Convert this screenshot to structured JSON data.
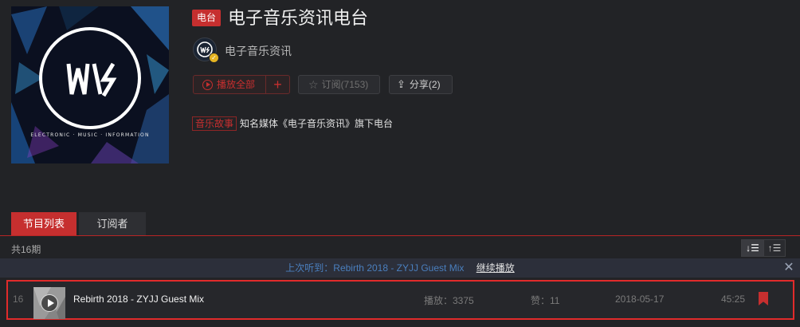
{
  "radio": {
    "type_badge": "电台",
    "title": "电子音乐资讯电台",
    "creator_name": "电子音乐资讯",
    "category": "音乐故事",
    "description": "知名媒体《电子音乐资讯》旗下电台",
    "cover_caption": "ELECTRONIC · MUSIC · INFORMATION"
  },
  "actions": {
    "play_all_label": "播放全部",
    "add_label": "+",
    "subscribe_label": "订阅(7153)",
    "share_label": "分享(2)"
  },
  "tabs": [
    {
      "label": "节目列表",
      "active": true
    },
    {
      "label": "订阅者",
      "active": false
    }
  ],
  "list": {
    "count_text": "共16期",
    "sort_desc_glyph": "↓☰",
    "sort_asc_glyph": "↑☰"
  },
  "last_played": {
    "prefix": "上次听到：",
    "title": "Rebirth 2018 - ZYJJ Guest Mix",
    "continue_label": "继续播放",
    "close_glyph": "✕"
  },
  "programs": [
    {
      "index": "16",
      "title": "Rebirth 2018 - ZYJJ Guest Mix",
      "plays": "播放：3375",
      "likes": "赞：11",
      "date": "2018-05-17",
      "duration": "45:25"
    }
  ],
  "colors": {
    "accent": "#c62f2f",
    "background": "#222326",
    "link": "#4a7fbe",
    "highlight_border": "#e12b2b"
  }
}
